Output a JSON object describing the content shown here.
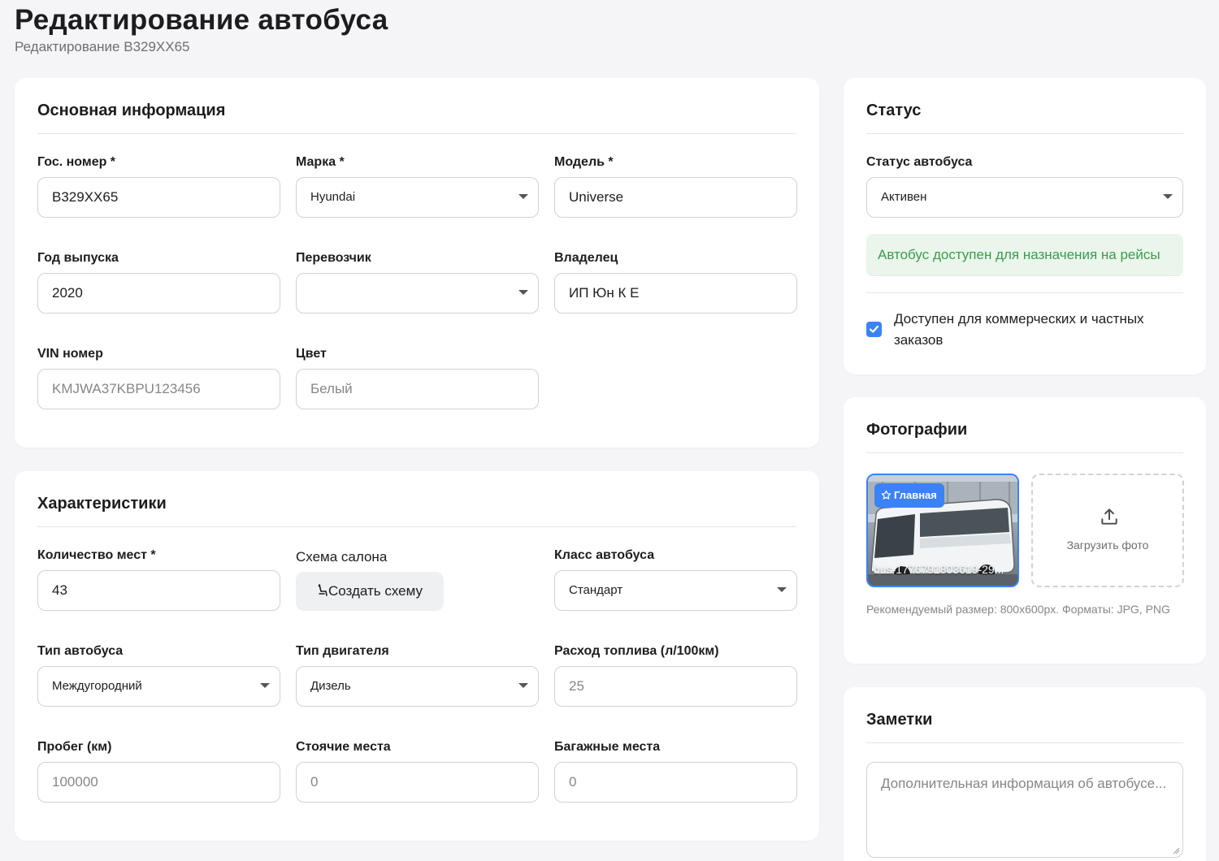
{
  "page": {
    "title": "Редактирование автобуса",
    "subtitle": "Редактирование B329XX65"
  },
  "basic_info": {
    "title": "Основная информация",
    "plate": {
      "label": "Гос. номер *",
      "value": "B329XX65"
    },
    "brand": {
      "label": "Марка *",
      "value": "Hyundai"
    },
    "model": {
      "label": "Модель *",
      "value": "Universe"
    },
    "year": {
      "label": "Год выпуска",
      "value": "2020"
    },
    "carrier": {
      "label": "Перевозчик",
      "value": ""
    },
    "owner": {
      "label": "Владелец",
      "value": "ИП Юн К Е"
    },
    "vin": {
      "label": "VIN номер",
      "placeholder": "KMJWA37KBPU123456"
    },
    "color": {
      "label": "Цвет",
      "placeholder": "Белый"
    }
  },
  "specs": {
    "title": "Характеристики",
    "seats": {
      "label": "Количество мест *",
      "value": "43"
    },
    "layout": {
      "label": "Схема салона",
      "button": "Создать схему"
    },
    "bus_class": {
      "label": "Класс автобуса",
      "value": "Стандарт"
    },
    "bus_type": {
      "label": "Тип автобуса",
      "value": "Междугородний"
    },
    "engine": {
      "label": "Тип двигателя",
      "value": "Дизель"
    },
    "fuel": {
      "label": "Расход топлива (л/100км)",
      "placeholder": "25"
    },
    "mileage": {
      "label": "Пробег (км)",
      "placeholder": "100000"
    },
    "standing": {
      "label": "Стоячие места",
      "placeholder": "0"
    },
    "luggage": {
      "label": "Багажные места",
      "placeholder": "0"
    }
  },
  "status": {
    "title": "Статус",
    "label": "Статус автобуса",
    "value": "Активен",
    "note": "Автобус доступен для назначения на рейсы",
    "commercial_label": "Доступен для коммерческих и частных заказов",
    "commercial_checked": true
  },
  "photos": {
    "title": "Фотографии",
    "main_badge": "Главная",
    "photo_name": "bus-1776791803619-29...",
    "upload_label": "Загрузить фото",
    "hint": "Рекомендуемый размер: 800x600px. Форматы: JPG, PNG"
  },
  "notes": {
    "title": "Заметки",
    "placeholder": "Дополнительная информация об автобусе..."
  },
  "colors": {
    "accent": "#3b82f6",
    "success_text": "#3d9a4c",
    "success_bg": "#eaf6ec",
    "page_bg": "#f5f5f7"
  }
}
